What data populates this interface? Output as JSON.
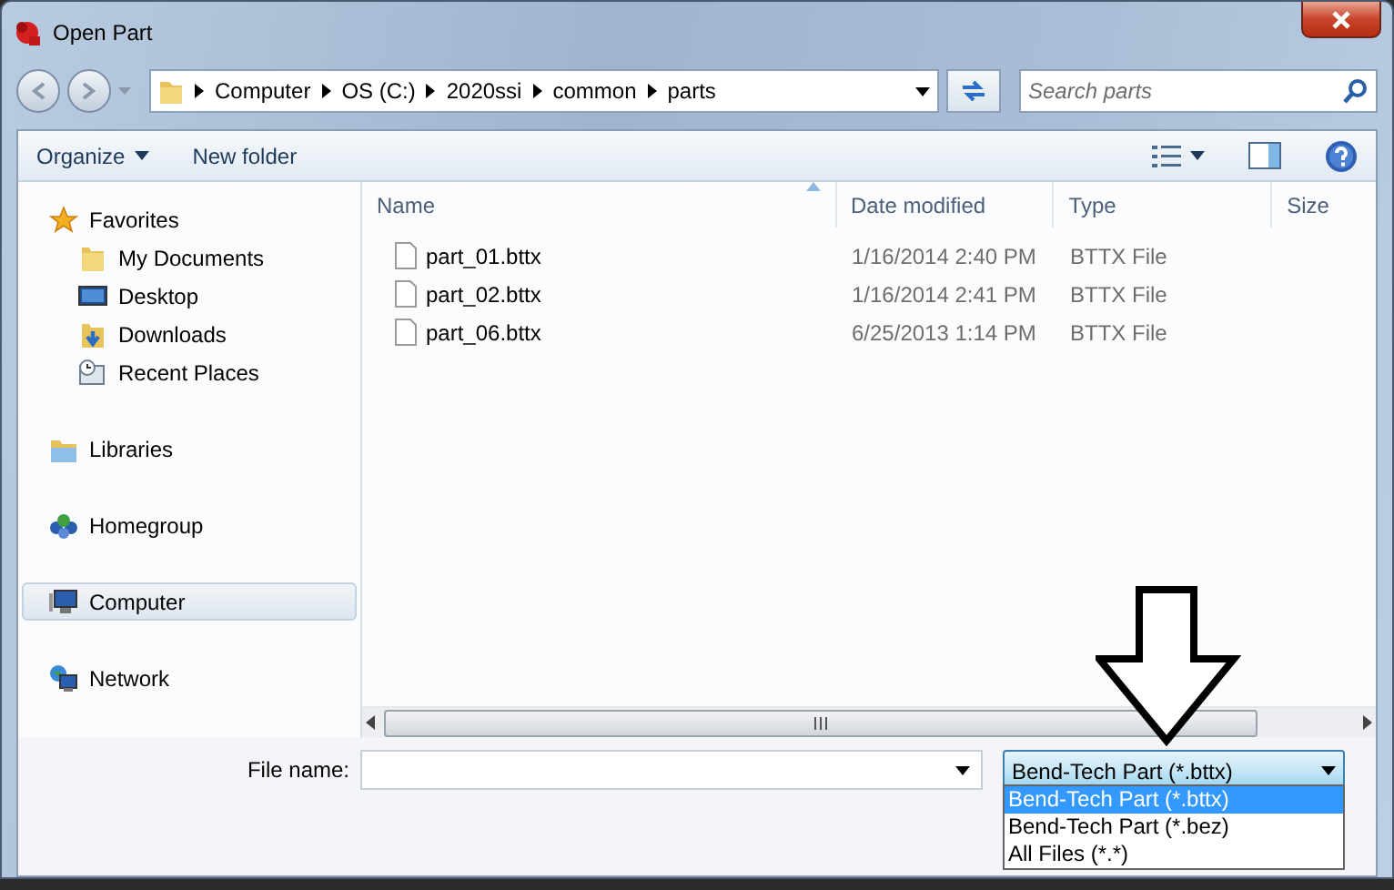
{
  "window": {
    "title": "Open Part"
  },
  "address": {
    "crumbs": [
      "Computer",
      "OS (C:)",
      "2020ssi",
      "common",
      "parts"
    ]
  },
  "search": {
    "placeholder": "Search parts"
  },
  "toolbar": [
    {
      "label": "Organize",
      "has_menu": true
    },
    {
      "label": "New folder",
      "has_menu": false
    }
  ],
  "sidebar": {
    "items": [
      {
        "label": "Favorites",
        "kind": "star",
        "selected": false,
        "children": [
          {
            "label": "My Documents",
            "kind": "folder",
            "selected": false
          },
          {
            "label": "Desktop",
            "kind": "desktop",
            "selected": false
          },
          {
            "label": "Downloads",
            "kind": "downloads",
            "selected": false
          },
          {
            "label": "Recent Places",
            "kind": "recent",
            "selected": false
          }
        ]
      },
      {
        "label": "Libraries",
        "kind": "library",
        "selected": false
      },
      {
        "label": "Homegroup",
        "kind": "homegroup",
        "selected": false
      },
      {
        "label": "Computer",
        "kind": "computer",
        "selected": true
      },
      {
        "label": "Network",
        "kind": "network",
        "selected": false
      }
    ]
  },
  "table": {
    "columns": [
      {
        "label": "Name",
        "sorted": true
      },
      {
        "label": "Date modified",
        "sorted": false
      },
      {
        "label": "Type",
        "sorted": false
      },
      {
        "label": "Size",
        "sorted": false
      }
    ],
    "rows": [
      {
        "name": "part_01.bttx",
        "date": "1/16/2014 2:40 PM",
        "type": "BTTX File"
      },
      {
        "name": "part_02.bttx",
        "date": "1/16/2014 2:41 PM",
        "type": "BTTX File"
      },
      {
        "name": "part_06.bttx",
        "date": "6/25/2013 1:14 PM",
        "type": "BTTX File"
      }
    ]
  },
  "file_name": {
    "label": "File name:"
  },
  "file_type": {
    "value": "Bend-Tech Part (*.bttx)",
    "expanded": true,
    "options": [
      {
        "label": "Bend-Tech Part (*.bttx)",
        "selected": true
      },
      {
        "label": "Bend-Tech Part (*.bez)",
        "selected": false
      },
      {
        "label": "All Files (*.*)",
        "selected": false
      }
    ]
  }
}
